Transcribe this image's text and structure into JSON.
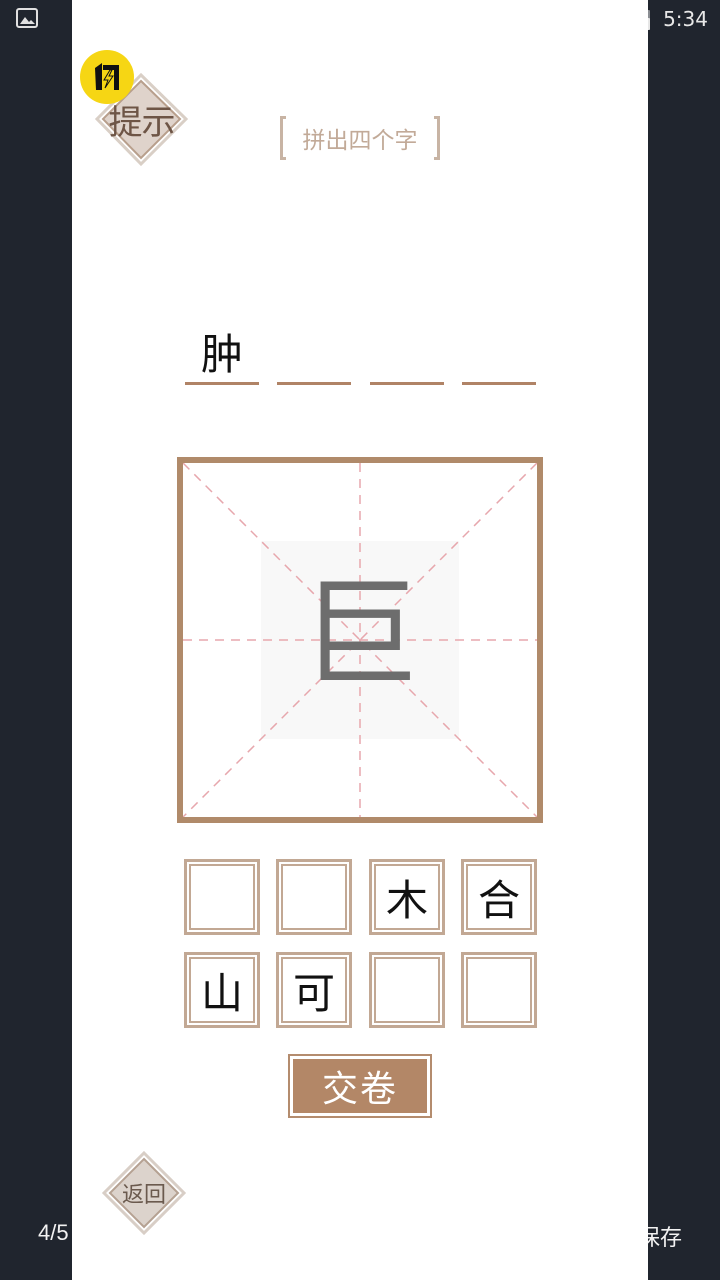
{
  "status_bar": {
    "time": "5:34",
    "icons": [
      "gallery-icon",
      "wifi-icon",
      "no-signal-icon",
      "battery-icon"
    ]
  },
  "viewer": {
    "page_counter": "4/5",
    "save_label": "保存"
  },
  "game": {
    "badge_icon": "shandian-logo-icon",
    "hint_label": "提示",
    "title": "拼出四个字",
    "answers": [
      "肿",
      "",
      "",
      ""
    ],
    "current_glyph": "巨",
    "tiles": [
      "",
      "",
      "木",
      "合",
      "山",
      "可",
      "",
      ""
    ],
    "submit_label": "交卷",
    "back_label": "返回"
  },
  "colors": {
    "accent_brown": "#b38767",
    "grid_guide_pink": "#e7a7ad",
    "badge_yellow": "#f6d614",
    "outer_background": "#20252e"
  }
}
